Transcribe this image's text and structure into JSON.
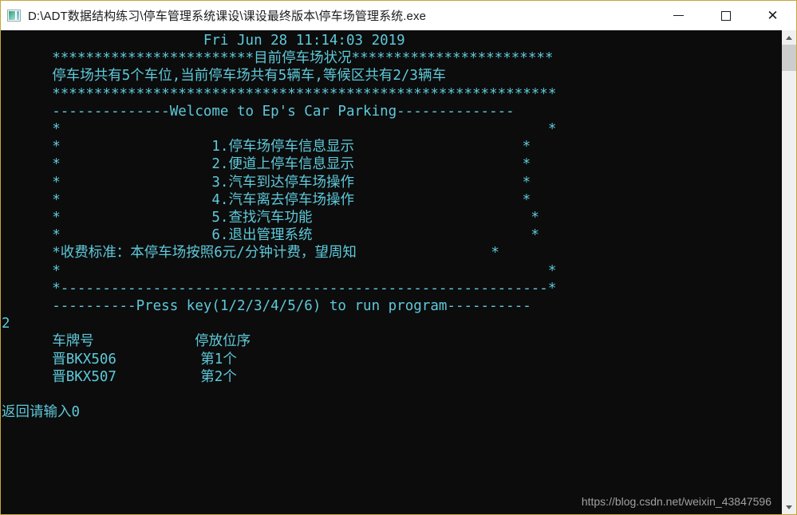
{
  "window": {
    "title": "D:\\ADT数据结构练习\\停车管理系统课设\\课设最终版本\\停车场管理系统.exe",
    "icon": "console-app-icon",
    "border_color": "#c8a53c",
    "buttons": {
      "minimize_label": "—",
      "maximize_label": "□",
      "close_label": "✕"
    }
  },
  "console": {
    "background_color": "#0c0c0c",
    "text_color": "#5ec9da",
    "datetime": "Fri Jun 28 11:14:03 2019",
    "status_banner": "************************目前停车场状况************************",
    "status_line": "停车场共有5个车位,当前停车场共有5辆车,等候区共有2/3辆车",
    "divider_stars": "************************************************************",
    "welcome_line": "--------------Welcome to Ep's Car Parking--------------",
    "menu_items": [
      "1.停车场停车信息显示",
      "2.便道上停车信息显示",
      "3.汽车到达停车场操作",
      "4.汽车离去停车场操作",
      "5.查找汽车功能",
      "6.退出管理系统"
    ],
    "fee_notice": "*收费标准：本停车场按照6元/分钟计费，望周知",
    "box_bottom": "*------------------------------------------------------*",
    "press_key_line": "----------Press key(1/2/3/4/5/6) to run program----------",
    "user_input": "2",
    "table": {
      "headers": [
        "车牌号",
        "停放位序"
      ],
      "rows": [
        [
          "晋BKX506",
          "第1个"
        ],
        [
          "晋BKX507",
          "第2个"
        ]
      ]
    },
    "return_prompt": "返回请输入0",
    "full_text": "                        Fri Jun 28 11:14:03 2019\n      ************************目前停车场状况************************\n      停车场共有5个车位,当前停车场共有5辆车,等候区共有2/3辆车\n      ************************************************************\n      --------------Welcome to Ep's Car Parking--------------\n      *                                                          *\n      *                  1.停车场停车信息显示                    *\n      *                  2.便道上停车信息显示                    *\n      *                  3.汽车到达停车场操作                    *\n      *                  4.汽车离去停车场操作                    *\n      *                  5.查找汽车功能                          *\n      *                  6.退出管理系统                          *\n      *收费标准：本停车场按照6元/分钟计费，望周知                *\n      *                                                          *\n      *----------------------------------------------------------*\n      ----------Press key(1/2/3/4/5/6) to run program----------\n2\n      车牌号            停放位序\n      晋BKX506          第1个\n      晋BKX507          第2个\n\n返回请输入0"
  },
  "watermark": {
    "text": "https://blog.csdn.net/weixin_43847596"
  },
  "scrollbar": {
    "up_icon": "chevron-up-icon",
    "down_icon": "chevron-down-icon"
  }
}
